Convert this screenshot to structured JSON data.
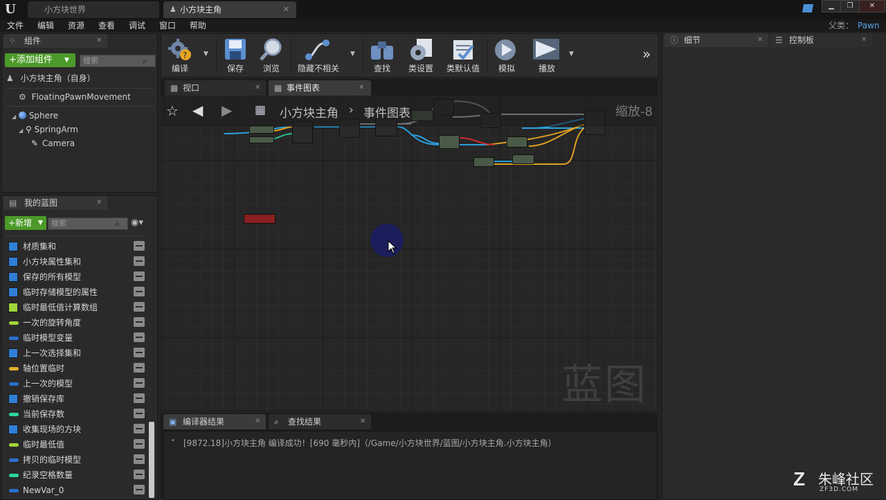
{
  "window": {
    "tabs": [
      {
        "label": "小方块世界",
        "active": false
      },
      {
        "label": "小方块主角",
        "active": true
      }
    ],
    "parent_label": "父类：",
    "parent_value": "Pawn"
  },
  "menu": [
    "文件",
    "编辑",
    "资源",
    "查看",
    "调试",
    "窗口",
    "帮助"
  ],
  "components": {
    "tab": "组件",
    "add_button": "+添加组件",
    "search_placeholder": "搜索",
    "self_label": "小方块主角（自身）",
    "items": [
      "FloatingPawnMovement",
      "Sphere",
      "SpringArm",
      "Camera"
    ]
  },
  "my_blueprint": {
    "tab": "我的蓝图",
    "new_button": "+新增",
    "search_placeholder": "搜索",
    "variables": [
      {
        "name": "材质集和",
        "icon": "grid",
        "color": "#2f7fd6"
      },
      {
        "name": "小方块属性集和",
        "icon": "grid",
        "color": "#2f7fd6"
      },
      {
        "name": "保存的所有模型",
        "icon": "grid",
        "color": "#2f7fd6"
      },
      {
        "name": "临时存储模型的属性",
        "icon": "grid",
        "color": "#2f7fd6"
      },
      {
        "name": "临时最低值计算数组",
        "icon": "grid",
        "color": "#9fd63a"
      },
      {
        "name": "一次的旋转角度",
        "icon": "pill",
        "color": "#9fd63a"
      },
      {
        "name": "临时模型变量",
        "icon": "pill",
        "color": "#2a6fd0"
      },
      {
        "name": "上一次选择集和",
        "icon": "grid",
        "color": "#2f7fd6"
      },
      {
        "name": "轴位置临时",
        "icon": "pill",
        "color": "#e0b02a"
      },
      {
        "name": "上一次的模型",
        "icon": "pill",
        "color": "#2a6fd0"
      },
      {
        "name": "撤销保存库",
        "icon": "grid",
        "color": "#2f7fd6"
      },
      {
        "name": "当前保存数",
        "icon": "pill",
        "color": "#2ad6a0"
      },
      {
        "name": "收集现场的方块",
        "icon": "grid",
        "color": "#2f7fd6"
      },
      {
        "name": "临时最低值",
        "icon": "pill",
        "color": "#9fd63a"
      },
      {
        "name": "拷贝的临时模型",
        "icon": "pill",
        "color": "#2a6fd0"
      },
      {
        "name": "纪录空格数量",
        "icon": "pill",
        "color": "#2ad6a0"
      },
      {
        "name": "NewVar_0",
        "icon": "pill",
        "color": "#2a6fd0"
      }
    ]
  },
  "toolbar": [
    {
      "label": "编译",
      "icon": "compile-icon"
    },
    {
      "label": "保存",
      "icon": "save-icon"
    },
    {
      "label": "浏览",
      "icon": "browse-icon"
    },
    {
      "label": "隐藏不相关",
      "icon": "hide-unrelated-icon"
    },
    {
      "label": "查找",
      "icon": "find-icon"
    },
    {
      "label": "类设置",
      "icon": "class-settings-icon"
    },
    {
      "label": "类默认值",
      "icon": "class-defaults-icon"
    },
    {
      "label": "模拟",
      "icon": "simulate-icon"
    },
    {
      "label": "播放",
      "icon": "play-icon"
    }
  ],
  "editor_tabs": [
    "视口",
    "事件图表"
  ],
  "graph": {
    "breadcrumb_root": "小方块主角",
    "breadcrumb_current": "事件图表",
    "zoom": "缩放-8",
    "watermark": "蓝图"
  },
  "right_panel": {
    "tabs": [
      "细节",
      "控制板"
    ]
  },
  "bottom": {
    "tabs": [
      "编译器结果",
      "查找结果"
    ],
    "log": "[9872.18]小方块主角 编译成功！[690 毫秒内]（/Game/小方块世界/蓝图/小方块主角.小方块主角）"
  },
  "brand": {
    "name": "朱峰社区",
    "url": "ZF3D.COM"
  }
}
